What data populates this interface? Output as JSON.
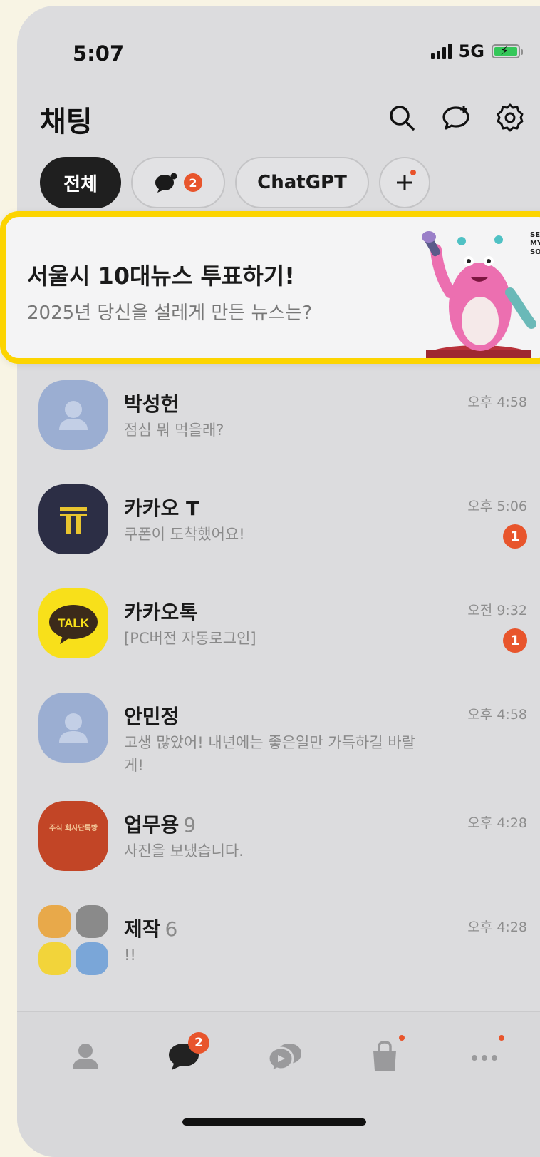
{
  "status_bar": {
    "time": "5:07",
    "network": "5G"
  },
  "header": {
    "title": "채팅"
  },
  "filters": [
    {
      "label": "전체",
      "active": true
    },
    {
      "label": "",
      "icon": "chat-bubble-icon",
      "badge": "2"
    },
    {
      "label": "ChatGPT"
    },
    {
      "label": "+",
      "icon": "plus-icon"
    }
  ],
  "banner": {
    "title": "서울시 10대뉴스 투표하기!",
    "subtitle": "2025년 당신을 설레게 만든 뉴스는?",
    "corner_text": "SEO MY SO"
  },
  "chats": [
    {
      "name": "박성헌",
      "member_count": "",
      "preview": "점심 뭐 먹을래?",
      "time": "오후 4:58",
      "unread": "",
      "avatar": "person"
    },
    {
      "name": "카카오 T",
      "member_count": "",
      "preview": "쿠폰이 도착했어요!",
      "time": "오후 5:06",
      "unread": "1",
      "avatar": "kakaot"
    },
    {
      "name": "카카오톡",
      "member_count": "",
      "preview": "[PC버전 자동로그인]",
      "time": "오전 9:32",
      "unread": "1",
      "avatar": "kakaotalk",
      "avatar_text": "TALK"
    },
    {
      "name": "안민정",
      "member_count": "",
      "preview": "고생 많았어! 내년에는 좋은일만 가득하길 바랄게!",
      "time": "오후 4:58",
      "unread": "",
      "avatar": "person"
    },
    {
      "name": "업무용",
      "member_count": "9",
      "preview": "사진을 보냈습니다.",
      "time": "오후 4:28",
      "unread": "",
      "avatar": "work",
      "avatar_text": "주식 회사단톡방"
    },
    {
      "name": "제작",
      "member_count": "6",
      "preview": "!!",
      "time": "오후 4:28",
      "unread": "",
      "avatar": "group"
    }
  ],
  "bottom_nav": [
    {
      "icon": "friends-icon"
    },
    {
      "icon": "chats-icon",
      "badge": "2"
    },
    {
      "icon": "openchat-icon"
    },
    {
      "icon": "shopping-icon",
      "dot": true
    },
    {
      "icon": "more-icon",
      "dot": true
    }
  ],
  "colors": {
    "background": "#dcdcde",
    "accent": "#e8552c",
    "banner_border": "#fcd400",
    "kakao_yellow": "#f8e01a"
  }
}
